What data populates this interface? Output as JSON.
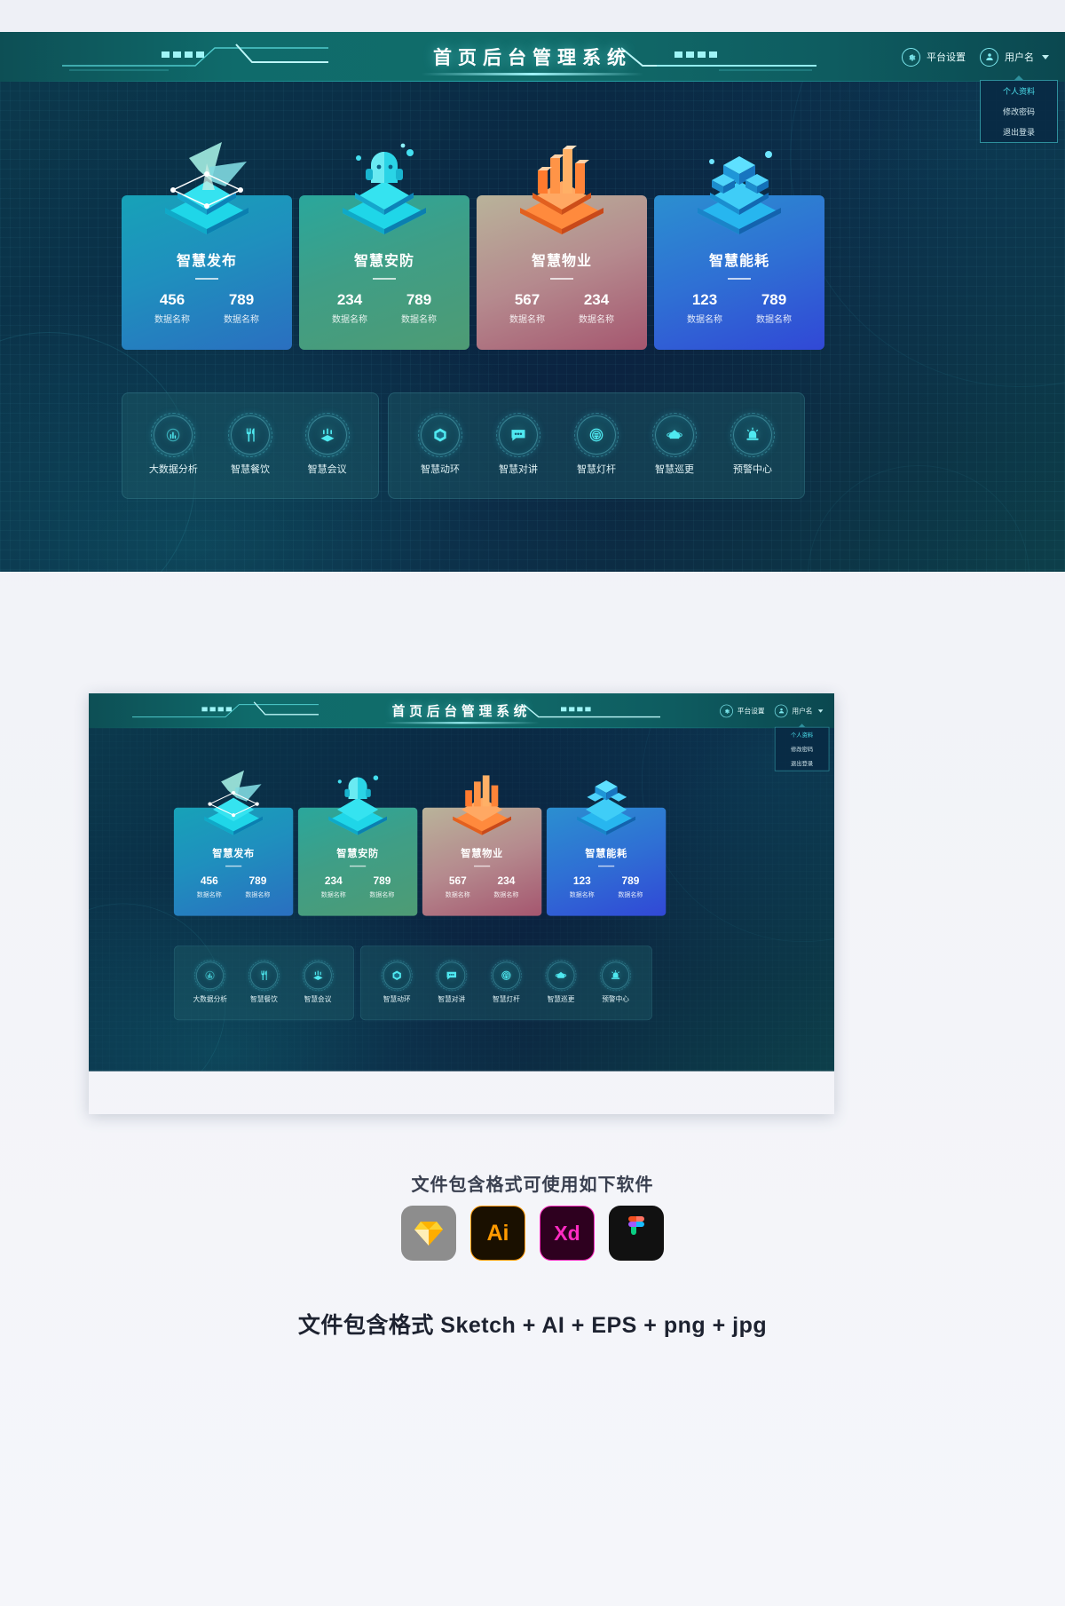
{
  "header": {
    "title": "首页后台管理系统",
    "platform_settings_label": "平台设置",
    "username_label": "用户名",
    "gear_icon": "gear-icon",
    "user_icon": "user-icon",
    "caret_icon": "chevron-down-icon"
  },
  "user_menu": {
    "items": [
      {
        "label": "个人资料",
        "active": true
      },
      {
        "label": "修改密码",
        "active": false
      },
      {
        "label": "退出登录",
        "active": false
      }
    ]
  },
  "cards": [
    {
      "title": "智慧发布",
      "icon": "broadcast-isometric-icon",
      "accent": "#17a2b8",
      "stats": [
        {
          "value": "456",
          "label": "数据名称"
        },
        {
          "value": "789",
          "label": "数据名称"
        }
      ]
    },
    {
      "title": "智慧安防",
      "icon": "security-head-isometric-icon",
      "accent": "#2aa79c",
      "stats": [
        {
          "value": "234",
          "label": "数据名称"
        },
        {
          "value": "789",
          "label": "数据名称"
        }
      ]
    },
    {
      "title": "智慧物业",
      "icon": "buildings-isometric-icon",
      "accent": "#a5566f",
      "stats": [
        {
          "value": "567",
          "label": "数据名称"
        },
        {
          "value": "234",
          "label": "数据名称"
        }
      ]
    },
    {
      "title": "智慧能耗",
      "icon": "energy-cubes-isometric-icon",
      "accent": "#3148d6",
      "stats": [
        {
          "value": "123",
          "label": "数据名称"
        },
        {
          "value": "789",
          "label": "数据名称"
        }
      ]
    }
  ],
  "panels": [
    {
      "features": [
        {
          "label": "大数据分析",
          "icon": "data-analysis-icon"
        },
        {
          "label": "智慧餐饮",
          "icon": "dining-fork-icon"
        },
        {
          "label": "智慧会议",
          "icon": "meeting-icon"
        }
      ]
    },
    {
      "features": [
        {
          "label": "智慧动环",
          "icon": "hexagon-power-icon"
        },
        {
          "label": "智慧对讲",
          "icon": "chat-bubble-icon"
        },
        {
          "label": "智慧灯杆",
          "icon": "street-lamp-icon"
        },
        {
          "label": "智慧巡更",
          "icon": "patrol-shield-icon"
        },
        {
          "label": "预警中心",
          "icon": "alarm-warning-icon"
        }
      ]
    }
  ],
  "footer": {
    "formats_caption": "文件包含格式可使用如下软件",
    "logos": [
      {
        "name": "sketch-logo",
        "text": "◆"
      },
      {
        "name": "illustrator-logo",
        "text": "Ai"
      },
      {
        "name": "xd-logo",
        "text": "Xd"
      },
      {
        "name": "figma-logo",
        "text": "F"
      }
    ],
    "final_line": "文件包含格式 Sketch + AI + EPS + png + jpg"
  }
}
